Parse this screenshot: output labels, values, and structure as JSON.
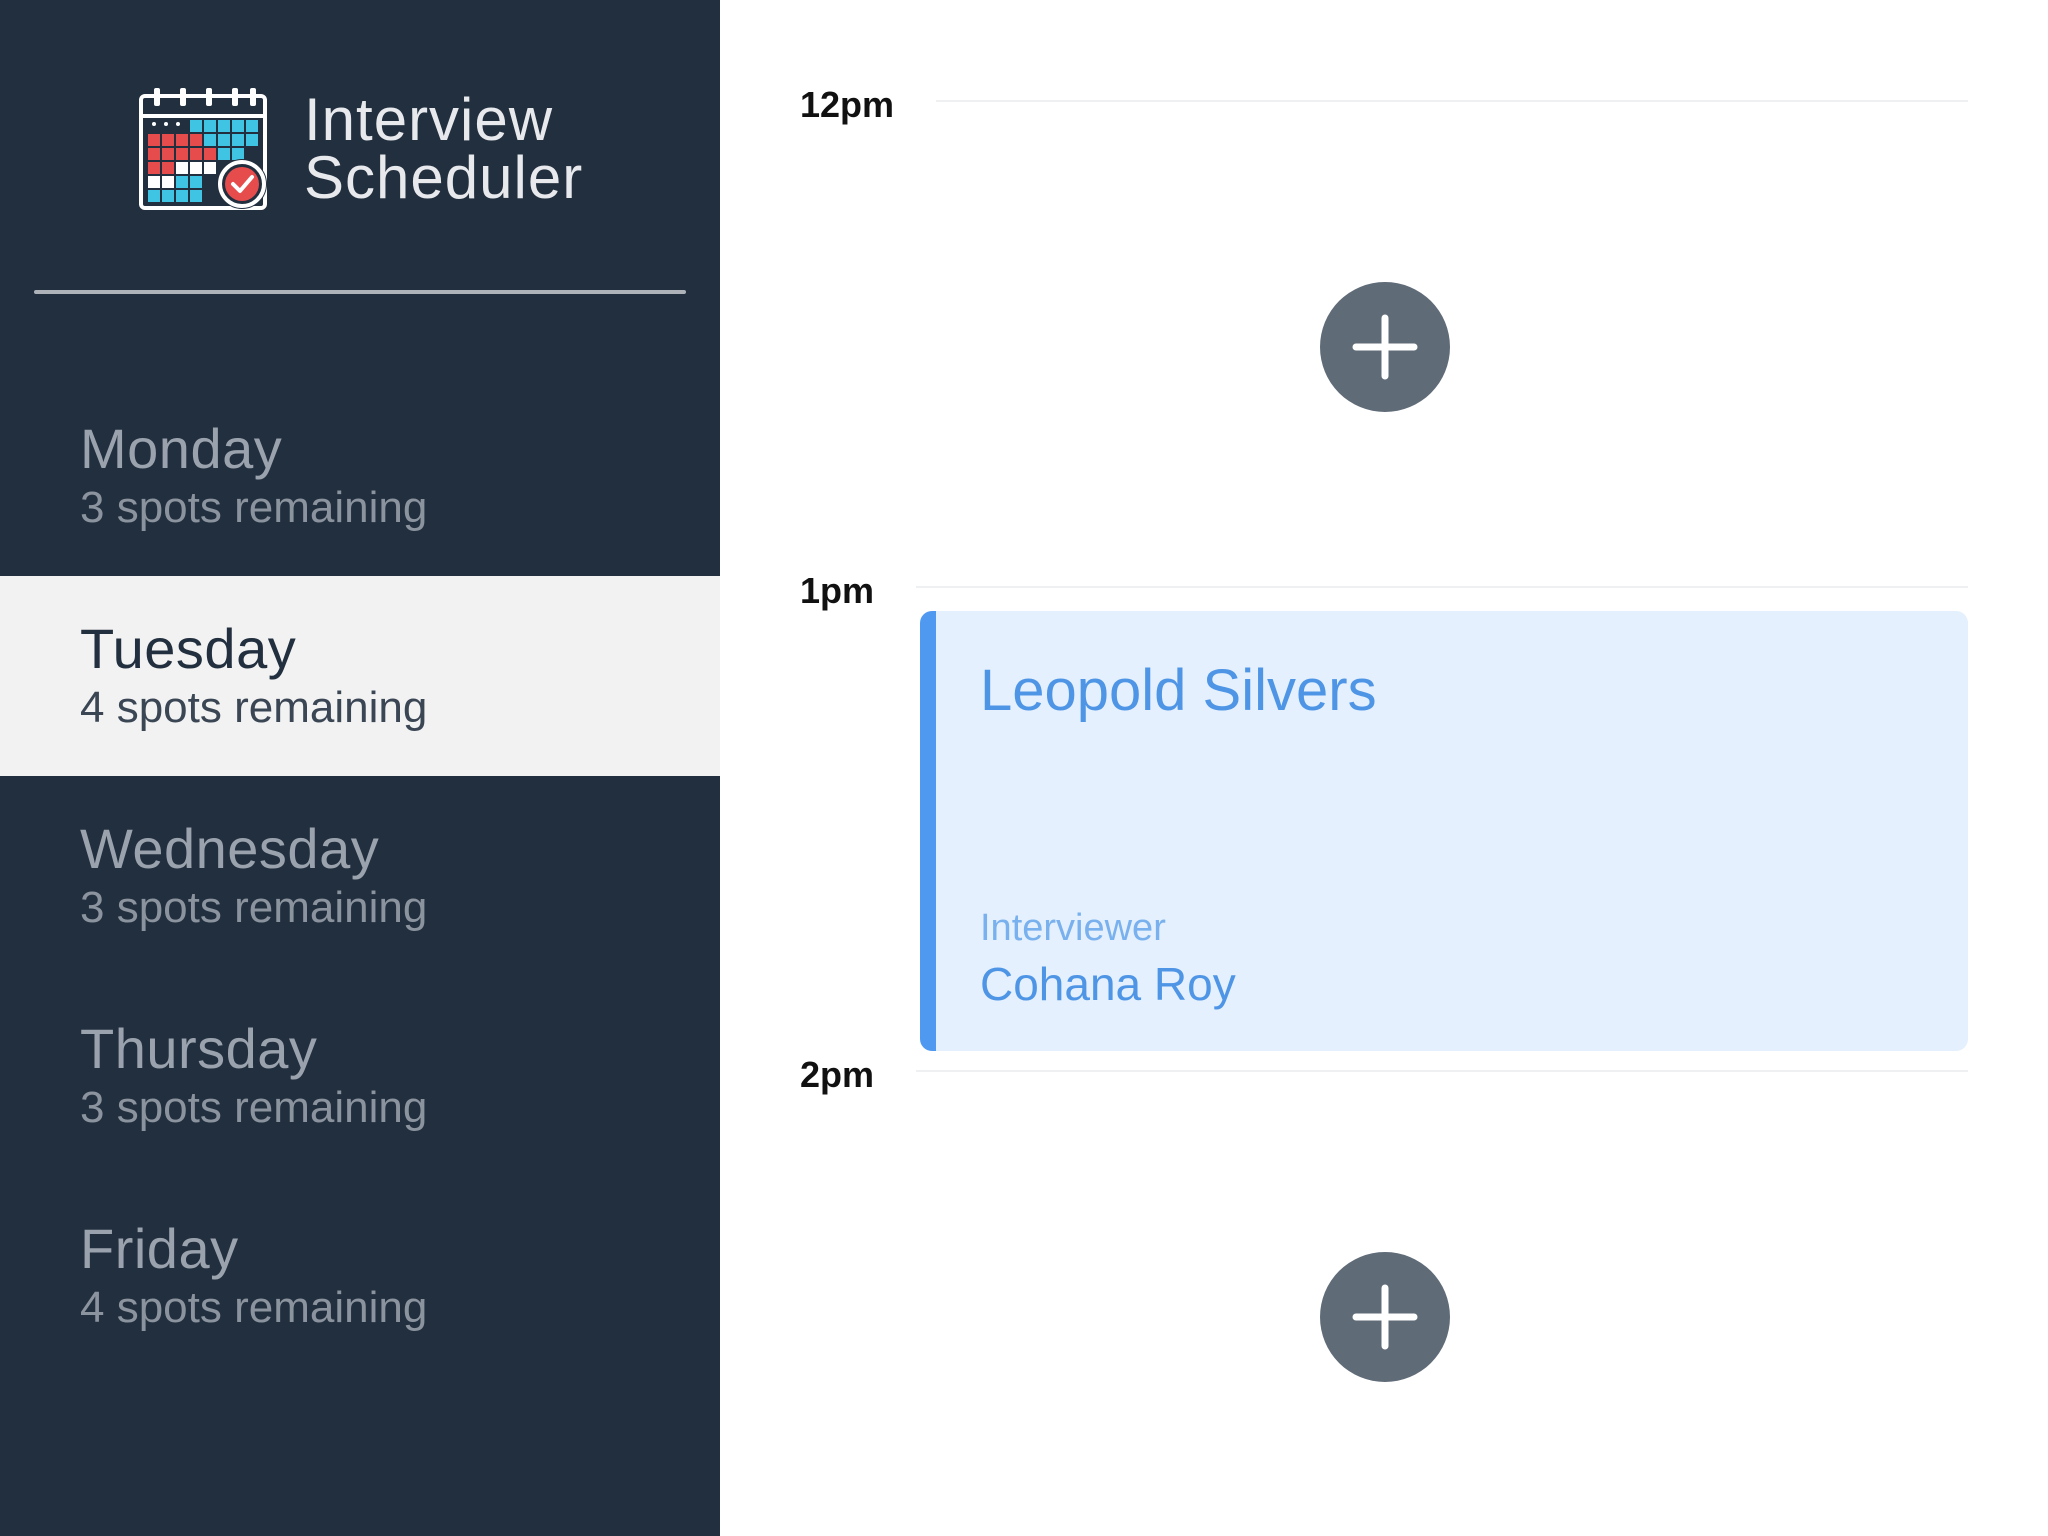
{
  "brand": {
    "logo_icon": "calendar-check-icon",
    "title_line1": "Interview",
    "title_line2": "Scheduler"
  },
  "days": [
    {
      "name": "Monday",
      "spots": "3 spots remaining",
      "selected": false
    },
    {
      "name": "Tuesday",
      "spots": "4 spots remaining",
      "selected": true
    },
    {
      "name": "Wednesday",
      "spots": "3 spots remaining",
      "selected": false
    },
    {
      "name": "Thursday",
      "spots": "3 spots remaining",
      "selected": false
    },
    {
      "name": "Friday",
      "spots": "4 spots remaining",
      "selected": false
    }
  ],
  "schedule": {
    "times": [
      "12pm",
      "1pm",
      "2pm"
    ],
    "add_icon": "plus-icon",
    "appointment": {
      "student": "Leopold Silvers",
      "interviewer_label": "Interviewer",
      "interviewer_name": "Cohana Roy"
    }
  },
  "colors": {
    "sidebar_bg": "#222f3f",
    "selected_bg": "#f2f2f2",
    "accent_blue": "#4f9af0",
    "card_bg": "#e4f0fd",
    "add_button": "#606b78"
  }
}
